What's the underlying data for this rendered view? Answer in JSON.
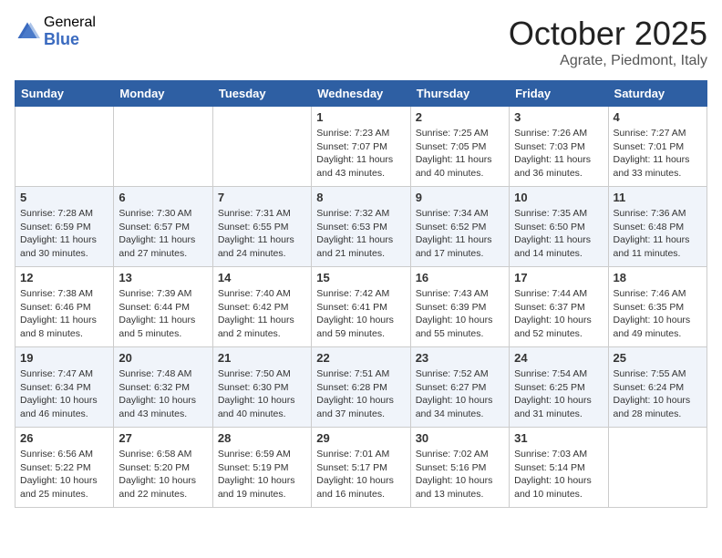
{
  "logo": {
    "general": "General",
    "blue": "Blue"
  },
  "title": "October 2025",
  "location": "Agrate, Piedmont, Italy",
  "days_of_week": [
    "Sunday",
    "Monday",
    "Tuesday",
    "Wednesday",
    "Thursday",
    "Friday",
    "Saturday"
  ],
  "weeks": [
    [
      {
        "num": "",
        "info": ""
      },
      {
        "num": "",
        "info": ""
      },
      {
        "num": "",
        "info": ""
      },
      {
        "num": "1",
        "info": "Sunrise: 7:23 AM\nSunset: 7:07 PM\nDaylight: 11 hours and 43 minutes."
      },
      {
        "num": "2",
        "info": "Sunrise: 7:25 AM\nSunset: 7:05 PM\nDaylight: 11 hours and 40 minutes."
      },
      {
        "num": "3",
        "info": "Sunrise: 7:26 AM\nSunset: 7:03 PM\nDaylight: 11 hours and 36 minutes."
      },
      {
        "num": "4",
        "info": "Sunrise: 7:27 AM\nSunset: 7:01 PM\nDaylight: 11 hours and 33 minutes."
      }
    ],
    [
      {
        "num": "5",
        "info": "Sunrise: 7:28 AM\nSunset: 6:59 PM\nDaylight: 11 hours and 30 minutes."
      },
      {
        "num": "6",
        "info": "Sunrise: 7:30 AM\nSunset: 6:57 PM\nDaylight: 11 hours and 27 minutes."
      },
      {
        "num": "7",
        "info": "Sunrise: 7:31 AM\nSunset: 6:55 PM\nDaylight: 11 hours and 24 minutes."
      },
      {
        "num": "8",
        "info": "Sunrise: 7:32 AM\nSunset: 6:53 PM\nDaylight: 11 hours and 21 minutes."
      },
      {
        "num": "9",
        "info": "Sunrise: 7:34 AM\nSunset: 6:52 PM\nDaylight: 11 hours and 17 minutes."
      },
      {
        "num": "10",
        "info": "Sunrise: 7:35 AM\nSunset: 6:50 PM\nDaylight: 11 hours and 14 minutes."
      },
      {
        "num": "11",
        "info": "Sunrise: 7:36 AM\nSunset: 6:48 PM\nDaylight: 11 hours and 11 minutes."
      }
    ],
    [
      {
        "num": "12",
        "info": "Sunrise: 7:38 AM\nSunset: 6:46 PM\nDaylight: 11 hours and 8 minutes."
      },
      {
        "num": "13",
        "info": "Sunrise: 7:39 AM\nSunset: 6:44 PM\nDaylight: 11 hours and 5 minutes."
      },
      {
        "num": "14",
        "info": "Sunrise: 7:40 AM\nSunset: 6:42 PM\nDaylight: 11 hours and 2 minutes."
      },
      {
        "num": "15",
        "info": "Sunrise: 7:42 AM\nSunset: 6:41 PM\nDaylight: 10 hours and 59 minutes."
      },
      {
        "num": "16",
        "info": "Sunrise: 7:43 AM\nSunset: 6:39 PM\nDaylight: 10 hours and 55 minutes."
      },
      {
        "num": "17",
        "info": "Sunrise: 7:44 AM\nSunset: 6:37 PM\nDaylight: 10 hours and 52 minutes."
      },
      {
        "num": "18",
        "info": "Sunrise: 7:46 AM\nSunset: 6:35 PM\nDaylight: 10 hours and 49 minutes."
      }
    ],
    [
      {
        "num": "19",
        "info": "Sunrise: 7:47 AM\nSunset: 6:34 PM\nDaylight: 10 hours and 46 minutes."
      },
      {
        "num": "20",
        "info": "Sunrise: 7:48 AM\nSunset: 6:32 PM\nDaylight: 10 hours and 43 minutes."
      },
      {
        "num": "21",
        "info": "Sunrise: 7:50 AM\nSunset: 6:30 PM\nDaylight: 10 hours and 40 minutes."
      },
      {
        "num": "22",
        "info": "Sunrise: 7:51 AM\nSunset: 6:28 PM\nDaylight: 10 hours and 37 minutes."
      },
      {
        "num": "23",
        "info": "Sunrise: 7:52 AM\nSunset: 6:27 PM\nDaylight: 10 hours and 34 minutes."
      },
      {
        "num": "24",
        "info": "Sunrise: 7:54 AM\nSunset: 6:25 PM\nDaylight: 10 hours and 31 minutes."
      },
      {
        "num": "25",
        "info": "Sunrise: 7:55 AM\nSunset: 6:24 PM\nDaylight: 10 hours and 28 minutes."
      }
    ],
    [
      {
        "num": "26",
        "info": "Sunrise: 6:56 AM\nSunset: 5:22 PM\nDaylight: 10 hours and 25 minutes."
      },
      {
        "num": "27",
        "info": "Sunrise: 6:58 AM\nSunset: 5:20 PM\nDaylight: 10 hours and 22 minutes."
      },
      {
        "num": "28",
        "info": "Sunrise: 6:59 AM\nSunset: 5:19 PM\nDaylight: 10 hours and 19 minutes."
      },
      {
        "num": "29",
        "info": "Sunrise: 7:01 AM\nSunset: 5:17 PM\nDaylight: 10 hours and 16 minutes."
      },
      {
        "num": "30",
        "info": "Sunrise: 7:02 AM\nSunset: 5:16 PM\nDaylight: 10 hours and 13 minutes."
      },
      {
        "num": "31",
        "info": "Sunrise: 7:03 AM\nSunset: 5:14 PM\nDaylight: 10 hours and 10 minutes."
      },
      {
        "num": "",
        "info": ""
      }
    ]
  ]
}
